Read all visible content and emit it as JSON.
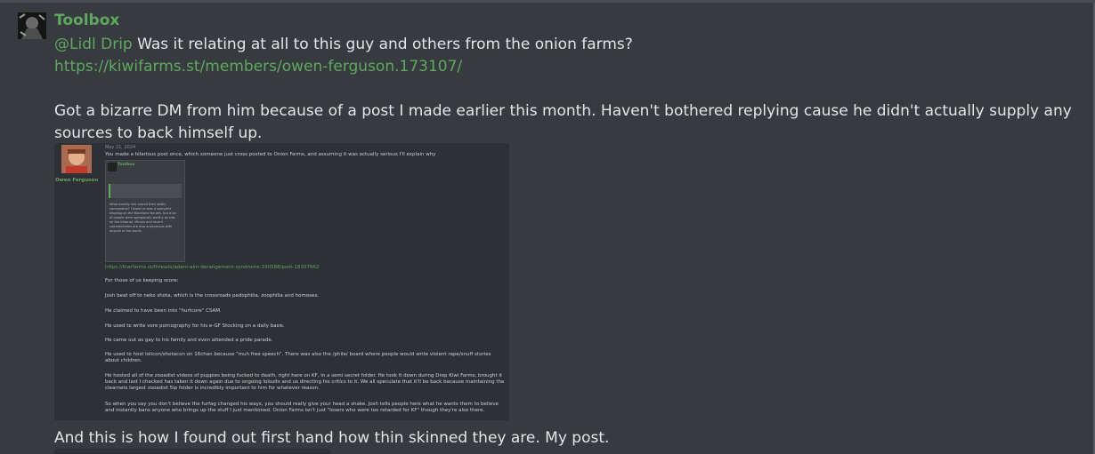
{
  "post": {
    "username": "Toolbox",
    "mention": "@Lidl Drip",
    "question": "Was it relating at all to this guy and others from the onion farms?",
    "link": "https://kiwifarms.st/members/owen-ferguson.173107/",
    "para1": "Got a bizarre DM from him because of a post I made earlier this month. Haven't bothered replying cause he didn't actually supply any",
    "para1b": "sources to back himself up.",
    "closing": "And this is how I found out first hand how thin skinned they are. My post."
  },
  "embed": {
    "date": "May 21, 2024",
    "intro": "You made a hilarious post once, which someone just cross posted to Onion Farms, and assuming it was actually serious I'll explain why",
    "author": "Owen Ferguson",
    "inner_name": "Toolbox",
    "inner_text": "What exactly has voiced their wildly comparable? I know he was a spergiest edgelog on the Blockland forums, but a lot of people were egregiously worthy as kids on the internet. Minors and recent commentaries are also anonymous with anyone in the world...",
    "link": "https://kiwifarms.st/threads/adam-aim-derangement-syndrome.190588/post-18307662",
    "items": [
      "For those of us keeping score:",
      "Josh beat off to neko shota, which is the crossroads pedophilia, zoophilia and homosex.",
      "He claimed to have been into \"hurtcore\" CSAM.",
      "He used to write vore pornography for his e-GF Stocking on a daily basis.",
      "He came out as gay to his family and even attended a pride parade.",
      "He used to host lolicon/shotacon on 16chan because \"muh free speech\". There was also the /phile/ board where people would write violent rape/snuff stories about children.",
      "He hosted all of the zooadist videos of puppies being fucked to death, right here on KF, in a semi secret folder. He took it down during Drop Kiwi Farms, brought it back and last I checked has taken it down again due to ongoing lolsuits and us directing his critics to it. We all speculate that it'll be back because maintaining the clearnets largest zooadist 5ip folder is incredibly important to him for whatever reason.",
      "So when you say you don't believe the furfag changed his ways, you should really give your head a shake. Josh tells people here what he wants them to believe and instantly bans anyone who brings up the stuff I just mentioned. Onion Farms isn't just \"losers who were too retarded for KF\" though they're also there."
    ]
  }
}
